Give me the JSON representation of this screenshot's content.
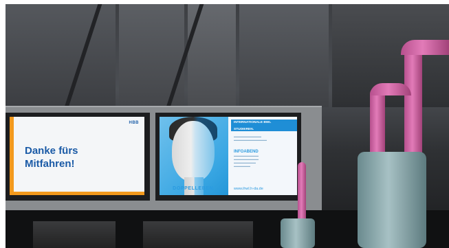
{
  "left_display": {
    "logo_text": "HBB",
    "logo_text_suffix": "",
    "message_line1": "Danke fürs",
    "message_line2": "Mitfahren!",
    "accent_color": "#f39a1e",
    "text_color": "#1a5aa6"
  },
  "right_display": {
    "banner_line1": "INTERNATIONALE BWL",
    "banner_line2": "STUDIEREN.",
    "event_title": "INFOABEND",
    "tagline": "DOPPELLEBEN.",
    "url": "www.ihwl.h-da.de",
    "accent_color": "#2b9be0"
  },
  "colors": {
    "grab_rail": "#e27bb8",
    "pole": "#a7c1c4"
  }
}
